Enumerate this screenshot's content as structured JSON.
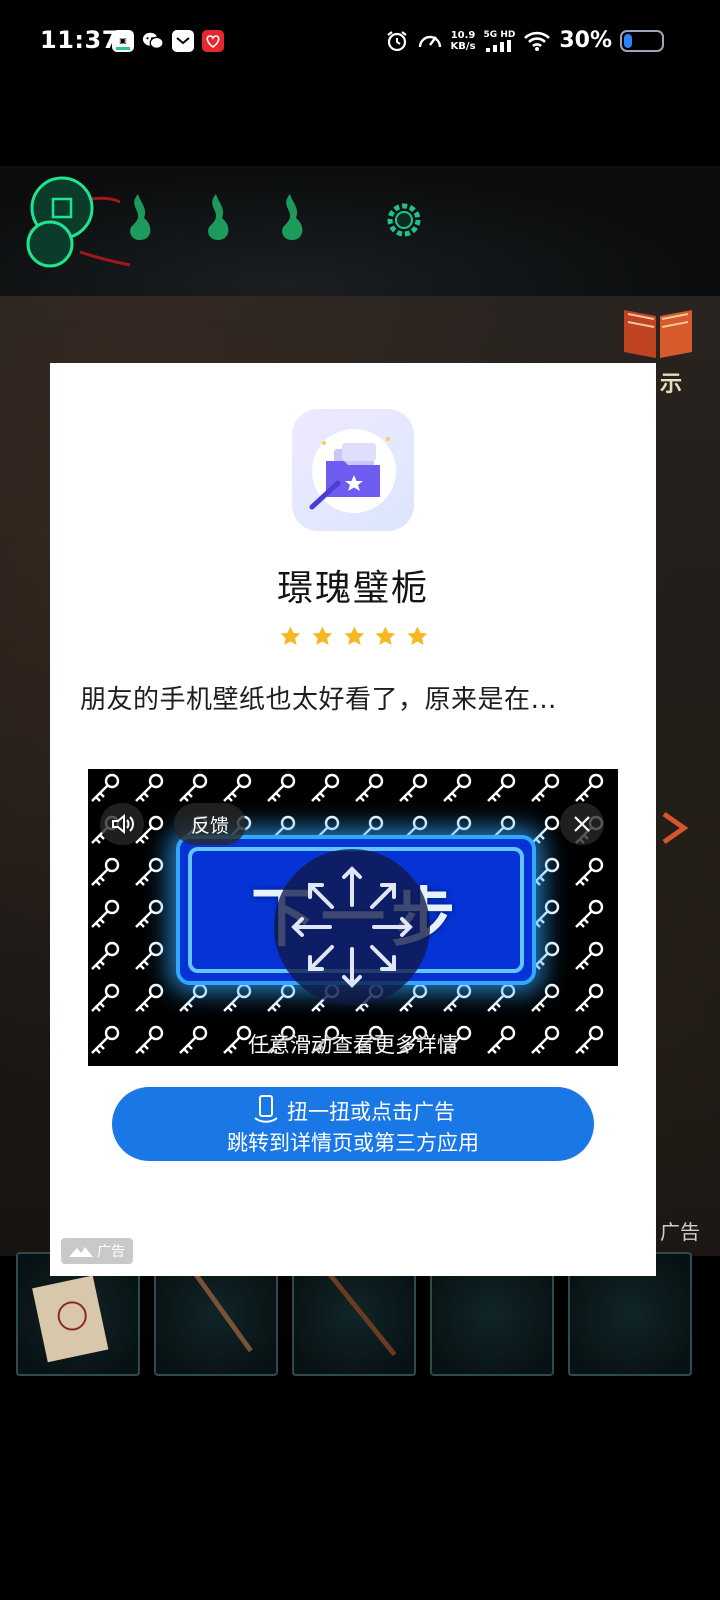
{
  "status_bar": {
    "time": "11:37",
    "net_speed_value": "10.9",
    "net_speed_unit": "KB/s",
    "signal_label": "5G HD",
    "battery_percent_text": "30%",
    "battery_level": 0.3
  },
  "game": {
    "hint_label": "示",
    "side_ad_label": "广告"
  },
  "ad": {
    "app_name": "璟瑰璧栀",
    "rating_stars": 5,
    "description": "朋友的手机壁纸也太好看了，原来是在…",
    "video": {
      "next_step_label": "下一步",
      "feedback_label": "反馈",
      "swipe_hint": "任意滑动查看更多详情"
    },
    "cta": {
      "line1": "扭一扭或点击广告",
      "line2": "跳转到详情页或第三方应用"
    },
    "badge_label": "广告"
  },
  "colors": {
    "cta_blue": "#1a78e6",
    "star_gold": "#f7b824",
    "next_button_blue": "#0633d6"
  }
}
